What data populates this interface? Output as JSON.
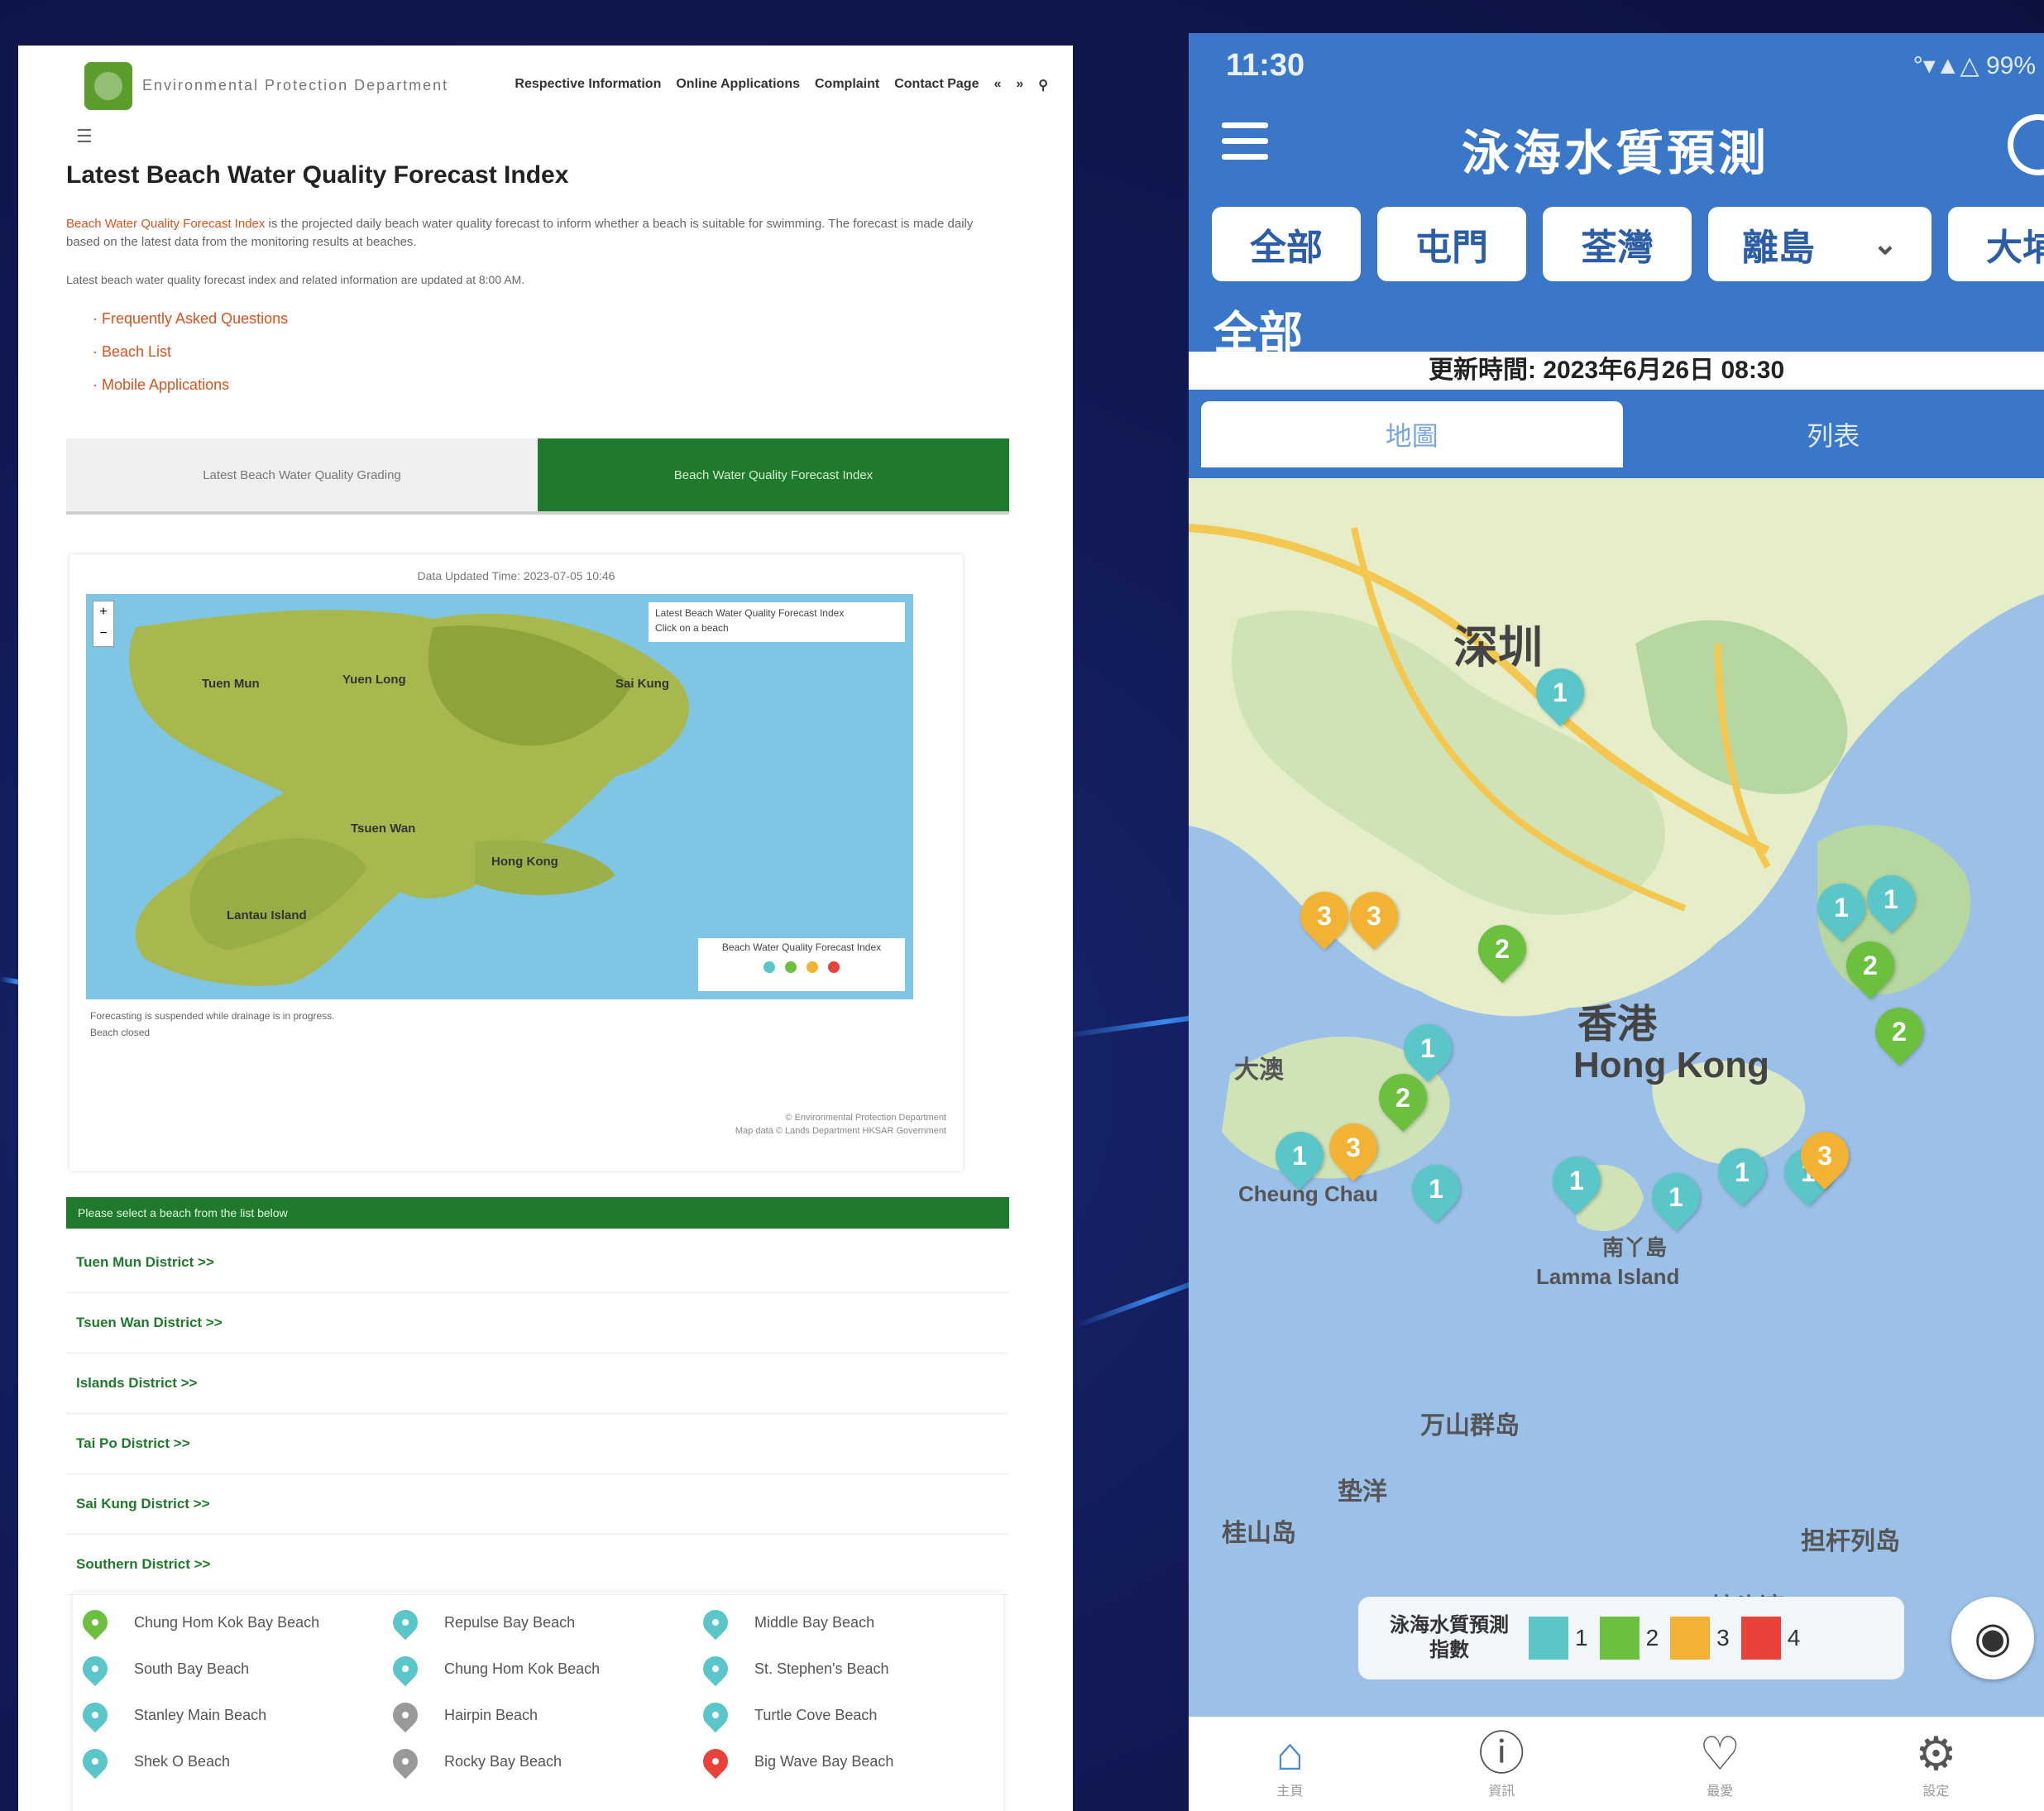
{
  "web": {
    "site_name": "Environmental Protection Department",
    "nav": [
      "Respective Information",
      "Online Applications",
      "Complaint",
      "Contact Page",
      "«",
      "»"
    ],
    "page_title": "Latest Beach Water Quality Forecast Index",
    "intro_link": "Beach Water Quality Forecast Index",
    "intro_text": " is the projected daily beach water quality forecast to inform whether a beach is suitable for swimming. The forecast is made daily based on the latest data from the monitoring results at beaches.",
    "intro2": "Latest beach water quality forecast index and related information are updated at 8:00 AM.",
    "links": [
      "Frequently Asked Questions",
      "Beach List",
      "Mobile Applications"
    ],
    "tabs": [
      "Latest Beach Water Quality Grading",
      "Beach Water Quality Forecast Index"
    ],
    "map": {
      "updated": "Data Updated Time: 2023-07-05 10:46",
      "popup_line1": "Latest Beach Water Quality Forecast Index",
      "popup_line2": "Click on a beach",
      "legend_title": "Beach Water Quality Forecast Index",
      "legend_colors": [
        "#5bc6c9",
        "#6cbf3f",
        "#f2b233",
        "#e8423b"
      ],
      "labels": [
        "Tuen Mun",
        "Yuen Long",
        "Sai Kung",
        "Tsuen Wan",
        "Lantau Island",
        "Hong Kong"
      ],
      "note1": "Forecasting is suspended while drainage is in progress.",
      "note2": "Beach closed",
      "credit1": "© Environmental Protection Department",
      "credit2": "Map data © Lands Department HKSAR Government"
    },
    "green_bar": "Please select a beach from the list below",
    "districts": [
      "Tuen Mun District >>",
      "Tsuen Wan District >>",
      "Islands District >>",
      "Tai Po District >>",
      "Sai Kung District >>",
      "Southern District >>"
    ],
    "beaches": [
      {
        "name": "Chung Hom Kok Bay Beach",
        "color": "#6cbf3f"
      },
      {
        "name": "Repulse Bay Beach",
        "color": "#5bc6c9"
      },
      {
        "name": "Middle Bay Beach",
        "color": "#5bc6c9"
      },
      {
        "name": "South Bay Beach",
        "color": "#5bc6c9"
      },
      {
        "name": "Chung Hom Kok Beach",
        "color": "#5bc6c9"
      },
      {
        "name": "St. Stephen's Beach",
        "color": "#5bc6c9"
      },
      {
        "name": "Stanley Main Beach",
        "color": "#5bc6c9"
      },
      {
        "name": "Hairpin Beach",
        "color": "#999999"
      },
      {
        "name": "Turtle Cove Beach",
        "color": "#5bc6c9"
      },
      {
        "name": "Shek O Beach",
        "color": "#5bc6c9"
      },
      {
        "name": "Rocky Bay Beach",
        "color": "#999999"
      },
      {
        "name": "Big Wave Bay Beach",
        "color": "#e8423b"
      }
    ]
  },
  "app": {
    "time": "11:30",
    "status_icons": "°▾▲△ 99%",
    "title": "泳海水質預測",
    "regions": [
      "全部",
      "屯門",
      "荃灣",
      "離島",
      "大埔"
    ],
    "section": "全部",
    "update_time": "更新時間: 2023年6月26日 08:30",
    "view_tabs": [
      "地圖",
      "列表"
    ],
    "map_labels": {
      "shenzhen": "深圳",
      "hk_cn": "香港",
      "hk_en": "Hong Kong",
      "cheung_chau": "Cheung Chau",
      "lamma": "Lamma Island",
      "lamma_cn": "南丫島",
      "tai_o": "大澳",
      "sea1": "万山群岛",
      "sea2": "垫洋",
      "sea3": "桂山岛",
      "sea4": "担杆列岛",
      "sea5": "蛇头湾"
    },
    "legend_title": "泳海水質預測指數",
    "legend": [
      {
        "n": "1",
        "color": "#5bc6c9"
      },
      {
        "n": "2",
        "color": "#6cbf3f"
      },
      {
        "n": "3",
        "color": "#f2b233"
      },
      {
        "n": "4",
        "color": "#e8423b"
      }
    ],
    "markers_n": [
      "1",
      "3",
      "3",
      "2",
      "1",
      "2",
      "3",
      "1",
      "1",
      "1",
      "1",
      "1",
      "2",
      "2",
      "1",
      "1",
      "1",
      "3"
    ],
    "bottom_nav": [
      "主頁",
      "資訊",
      "最愛",
      "設定"
    ],
    "bottom_icons": [
      "home-icon",
      "info-icon",
      "heart-icon",
      "gear-icon"
    ]
  }
}
